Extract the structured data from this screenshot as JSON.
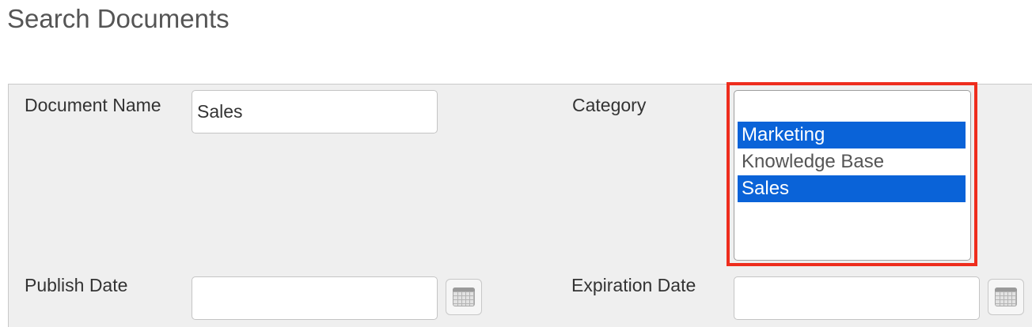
{
  "page": {
    "title": "Search Documents"
  },
  "form": {
    "document_name": {
      "label": "Document Name",
      "value": "Sales"
    },
    "category": {
      "label": "Category",
      "options": [
        {
          "label": "Marketing",
          "selected": true
        },
        {
          "label": "Knowledge Base",
          "selected": false
        },
        {
          "label": "Sales",
          "selected": true
        }
      ]
    },
    "publish_date": {
      "label": "Publish Date",
      "value": "",
      "icon": "calendar-icon"
    },
    "expiration_date": {
      "label": "Expiration Date",
      "value": "",
      "icon": "calendar-icon"
    }
  },
  "colors": {
    "selection": "#0a63d8",
    "highlight_frame": "#ee2d1d",
    "panel_background": "#efefef"
  }
}
